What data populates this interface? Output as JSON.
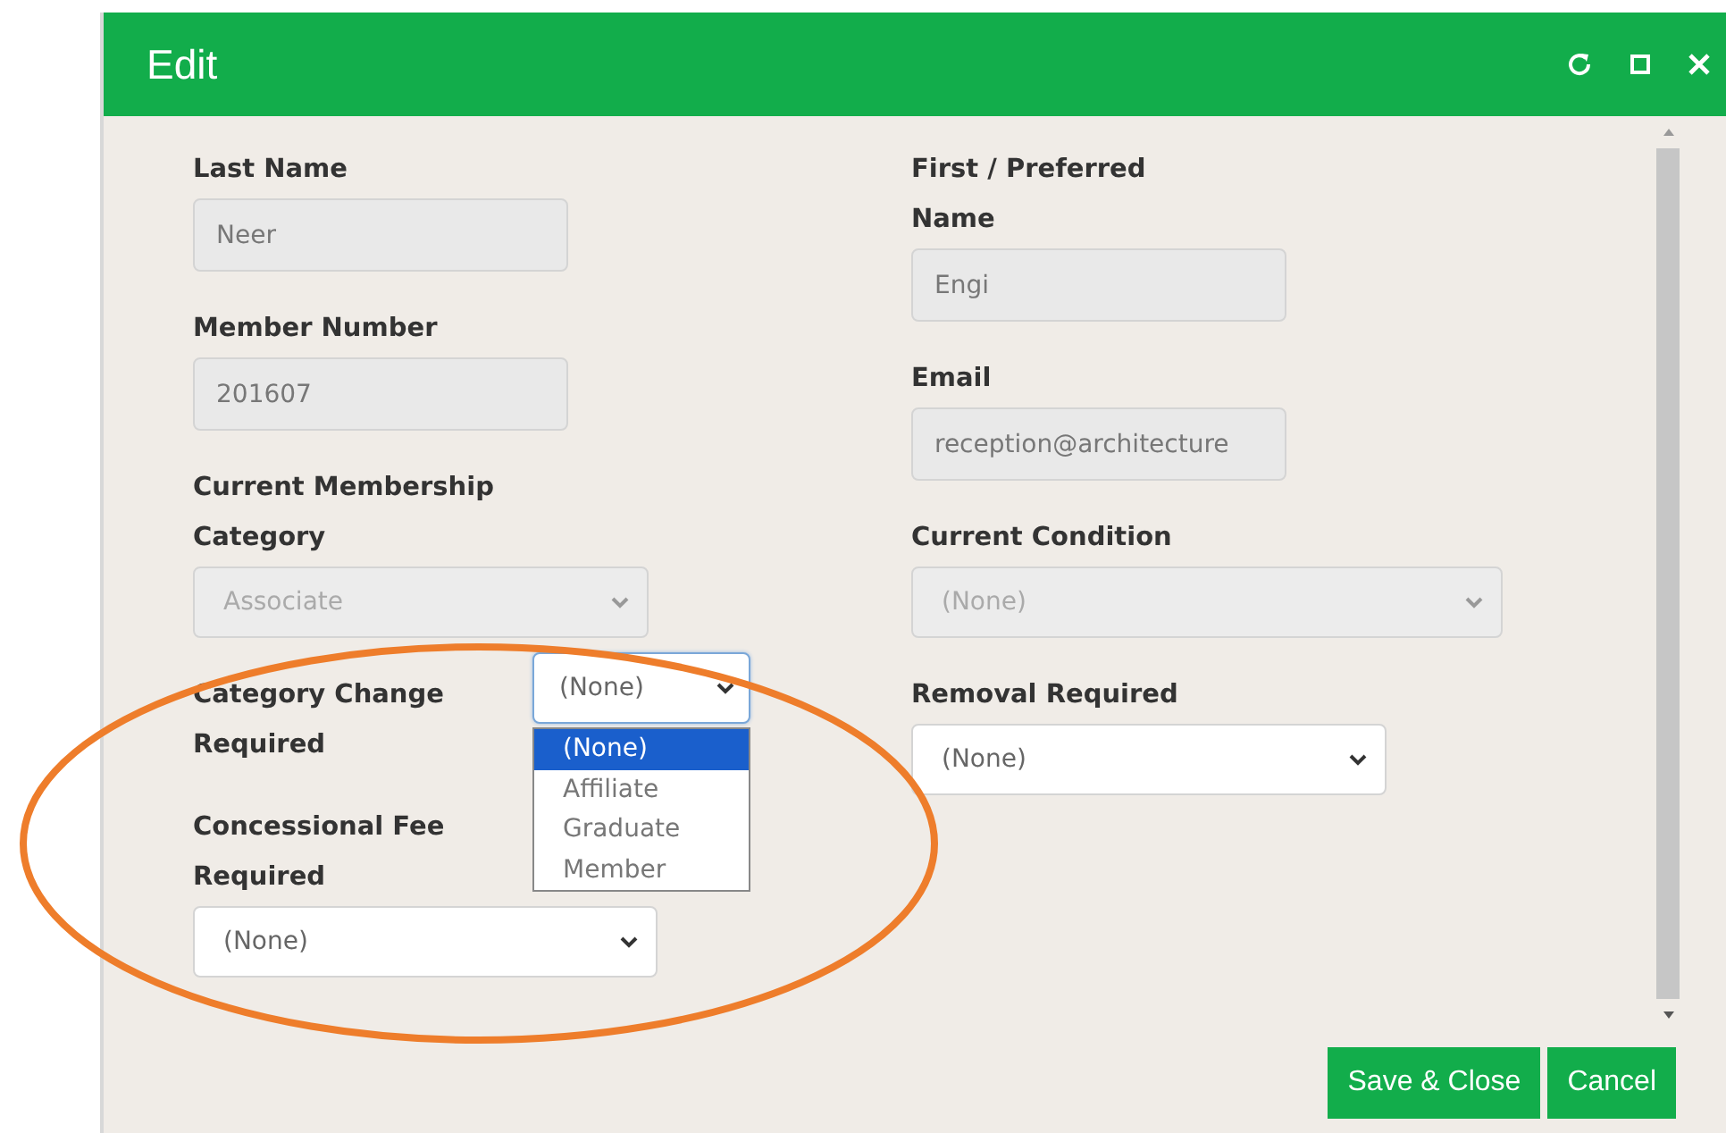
{
  "window": {
    "title": "Edit"
  },
  "left_fields": [
    {
      "label": "Last Name",
      "kind": "text",
      "value": "Neer",
      "disabled": true
    },
    {
      "label": "Member Number",
      "kind": "text",
      "value": "201607",
      "disabled": true
    },
    {
      "label": "Current Membership Category",
      "kind": "select",
      "value": "Associate",
      "disabled": true
    },
    {
      "label": "Category Change Required",
      "kind": "inline-select",
      "value": "(None)",
      "disabled": false,
      "open": true,
      "options": [
        {
          "label": "(None)",
          "selected": true
        },
        {
          "label": "Affiliate",
          "selected": false
        },
        {
          "label": "Graduate",
          "selected": false
        },
        {
          "label": "Member",
          "selected": false
        }
      ]
    },
    {
      "label": "Concessional Fee Required",
      "kind": "select",
      "value": "(None)",
      "disabled": false
    }
  ],
  "right_fields": [
    {
      "label": "First / Preferred Name",
      "kind": "text",
      "value": "Engi",
      "disabled": true
    },
    {
      "label": "Email",
      "kind": "text",
      "value": "reception@architecture",
      "disabled": true
    },
    {
      "label": "Current Condition",
      "kind": "select",
      "value": "(None)",
      "disabled": true
    },
    {
      "label": "Removal Required",
      "kind": "select",
      "value": "(None)",
      "disabled": false
    }
  ],
  "buttons": [
    {
      "label": "Save & Close"
    },
    {
      "label": "Cancel"
    }
  ]
}
